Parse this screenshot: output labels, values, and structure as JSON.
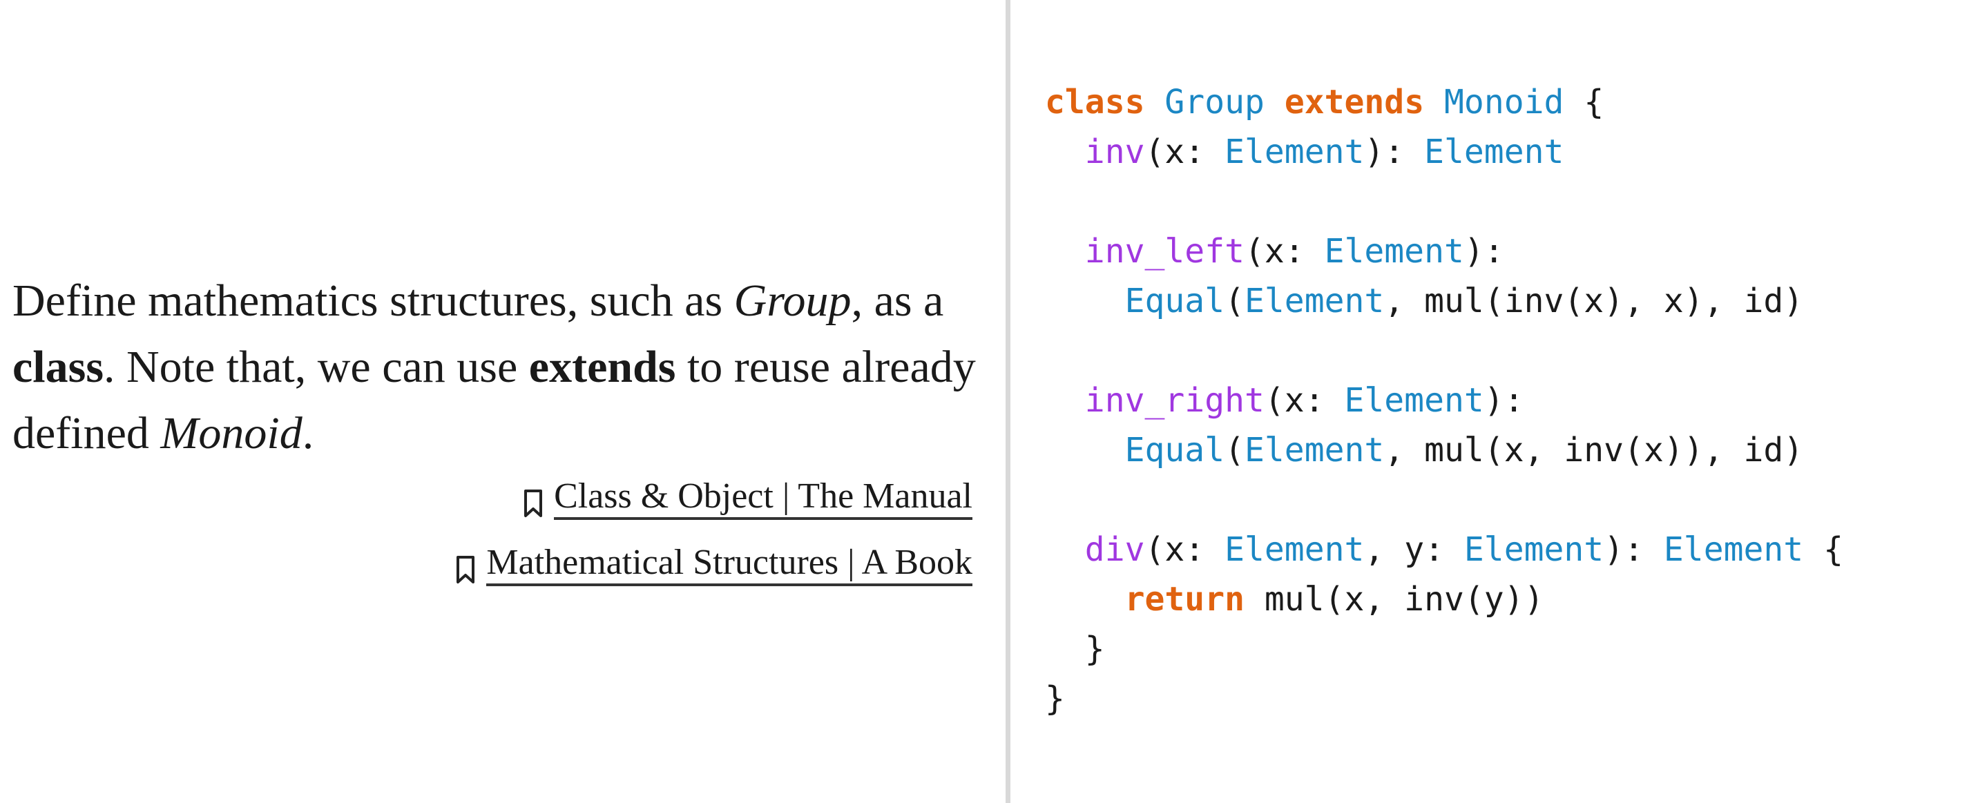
{
  "prose": {
    "t1": "Define mathematics structures, such as ",
    "group": "Group",
    "t2": ", as a ",
    "class_word": "class",
    "t3": ". Note that, we can use ",
    "extends_word": "extends",
    "t4": " to reuse already defined ",
    "monoid": "Monoid",
    "t5": "."
  },
  "references": [
    {
      "label": "Class & Object | The Manual",
      "icon": "bookmark-icon"
    },
    {
      "label": "Mathematical Structures | A Book",
      "icon": "bookmark-icon"
    }
  ],
  "code": {
    "l1": {
      "kw_class": "class",
      "name": "Group",
      "kw_extends": "extends",
      "parent": "Monoid",
      "brace": "{"
    },
    "l2": {
      "fn": "inv",
      "p1": "(x: ",
      "t1": "Element",
      "p2": "): ",
      "t2": "Element"
    },
    "l4": {
      "fn": "inv_left",
      "p1": "(x: ",
      "t1": "Element",
      "p2": "):"
    },
    "l5": {
      "eq": "Equal",
      "p1": "(",
      "t1": "Element",
      "p2": ", mul(inv(x), x), id)"
    },
    "l7": {
      "fn": "inv_right",
      "p1": "(x: ",
      "t1": "Element",
      "p2": "):"
    },
    "l8": {
      "eq": "Equal",
      "p1": "(",
      "t1": "Element",
      "p2": ", mul(x, inv(x)), id)"
    },
    "l10": {
      "fn": "div",
      "p1": "(x: ",
      "t1": "Element",
      "p2": ", y: ",
      "t2": "Element",
      "p3": "): ",
      "t3": "Element",
      "p4": " {"
    },
    "l11": {
      "kw": "return",
      "rest": " mul(x, inv(y))"
    },
    "l12": {
      "brace": "}"
    },
    "l13": {
      "brace": "}"
    }
  },
  "colors": {
    "keyword": "#e0620f",
    "type": "#1b87c4",
    "function": "#a037e0",
    "divider": "#d9d9d9"
  }
}
